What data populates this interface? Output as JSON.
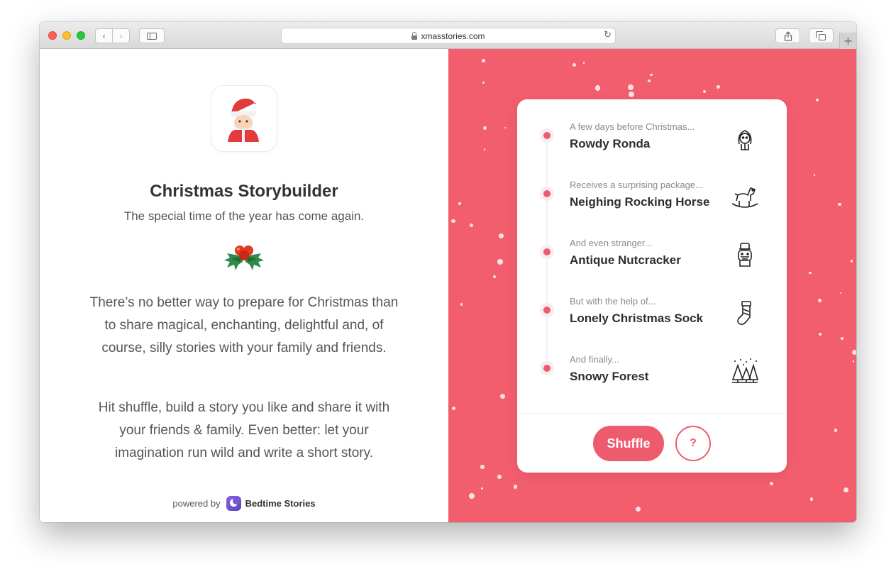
{
  "browser": {
    "url": "xmasstories.com",
    "back_icon": "‹",
    "forward_icon": "›",
    "reload_icon": "↻",
    "newtab_icon": "+"
  },
  "intro": {
    "app_icon": "santa-icon",
    "title": "Christmas Storybuilder",
    "subtitle": "The special time of the year has come again.",
    "decoration_icon": "holly-icon",
    "paragraph1": "There’s no better way to prepare for Christmas than to share magical, enchanting, delightful and, of course, silly stories with your family and friends.",
    "paragraph2": "Hit shuffle, build a story you like and share it with your friends & family. Even better: let your imagination run wild and write a short story.",
    "powered_by": "powered by",
    "brand_name": "Bedtime Stories"
  },
  "story": {
    "items": [
      {
        "prompt": "A few days before Christmas...",
        "answer": "Rowdy Ronda",
        "icon": "girl-icon"
      },
      {
        "prompt": "Receives a surprising package...",
        "answer": "Neighing Rocking Horse",
        "icon": "rocking-horse-icon"
      },
      {
        "prompt": "And even stranger...",
        "answer": "Antique Nutcracker",
        "icon": "nutcracker-icon"
      },
      {
        "prompt": "But with the help of...",
        "answer": "Lonely Christmas Sock",
        "icon": "stocking-icon"
      },
      {
        "prompt": "And finally...",
        "answer": "Snowy Forest",
        "icon": "forest-icon"
      }
    ],
    "shuffle_label": "Shuffle",
    "help_label": "?"
  },
  "colors": {
    "accent": "#ee5b6c",
    "panel_background": "#f25e6e",
    "brand_purple": "#7a55d6"
  }
}
